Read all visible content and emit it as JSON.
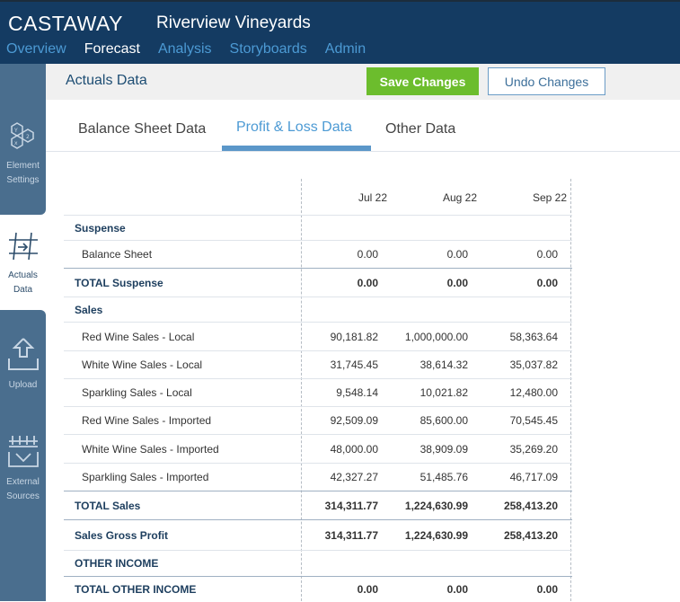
{
  "header": {
    "logo": "CASTAWAY",
    "company": "Riverview Vineyards",
    "nav": [
      "Overview",
      "Forecast",
      "Analysis",
      "Storyboards",
      "Admin"
    ],
    "active_nav": "Forecast"
  },
  "sidebar": {
    "items": [
      {
        "label_1": "Element",
        "label_2": "Settings",
        "icon": "hexagon-icon"
      },
      {
        "label_1": "Actuals",
        "label_2": "Data",
        "icon": "grid-arrow-icon"
      },
      {
        "label_1": "Upload",
        "label_2": "",
        "icon": "upload-icon"
      },
      {
        "label_1": "External",
        "label_2": "Sources",
        "icon": "database-download-icon"
      }
    ]
  },
  "main": {
    "title": "Actuals Data",
    "save_label": "Save Changes",
    "undo_label": "Undo Changes",
    "tabs": [
      "Balance Sheet Data",
      "Profit & Loss Data",
      "Other Data"
    ],
    "active_tab": "Profit & Loss Data"
  },
  "table": {
    "columns": [
      "Jul 22",
      "Aug 22",
      "Sep 22"
    ],
    "rows": [
      {
        "label": "Suspense",
        "type": "section",
        "values": [
          "",
          "",
          ""
        ]
      },
      {
        "label": "Balance Sheet",
        "type": "item",
        "values": [
          "0.00",
          "0.00",
          "0.00"
        ]
      },
      {
        "label": "TOTAL Suspense",
        "type": "total",
        "values": [
          "0.00",
          "0.00",
          "0.00"
        ]
      },
      {
        "label": "Sales",
        "type": "section",
        "values": [
          "",
          "",
          ""
        ]
      },
      {
        "label": "Red Wine Sales - Local",
        "type": "item",
        "values": [
          "90,181.82",
          "1,000,000.00",
          "58,363.64"
        ]
      },
      {
        "label": "White Wine Sales - Local",
        "type": "item",
        "values": [
          "31,745.45",
          "38,614.32",
          "35,037.82"
        ]
      },
      {
        "label": "Sparkling Sales - Local",
        "type": "item",
        "values": [
          "9,548.14",
          "10,021.82",
          "12,480.00"
        ]
      },
      {
        "label": "Red Wine Sales - Imported",
        "type": "item",
        "values": [
          "92,509.09",
          "85,600.00",
          "70,545.45"
        ]
      },
      {
        "label": "White Wine Sales - Imported",
        "type": "item",
        "values": [
          "48,000.00",
          "38,909.09",
          "35,269.20"
        ]
      },
      {
        "label": "Sparkling Sales - Imported",
        "type": "item",
        "values": [
          "42,327.27",
          "51,485.76",
          "46,717.09"
        ]
      },
      {
        "label": "TOTAL Sales",
        "type": "total",
        "values": [
          "314,311.77",
          "1,224,630.99",
          "258,413.20"
        ]
      },
      {
        "label": "Sales Gross Profit",
        "type": "total",
        "values": [
          "314,311.77",
          "1,224,630.99",
          "258,413.20"
        ]
      },
      {
        "label": "OTHER INCOME",
        "type": "section",
        "values": [
          "",
          "",
          ""
        ]
      },
      {
        "label": "TOTAL OTHER INCOME",
        "type": "total",
        "values": [
          "0.00",
          "0.00",
          "0.00"
        ]
      }
    ]
  }
}
